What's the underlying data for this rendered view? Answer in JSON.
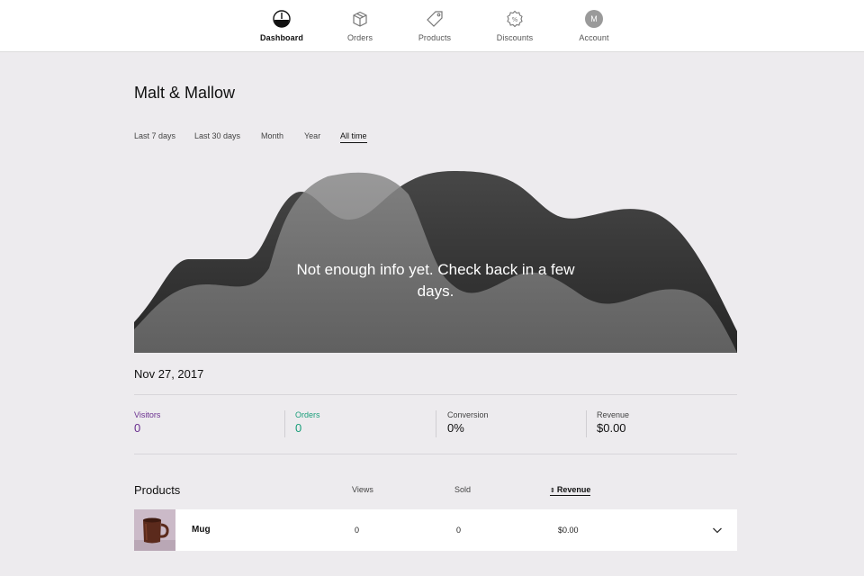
{
  "nav": {
    "items": [
      {
        "label": "Dashboard",
        "icon": "dashboard-gauge-icon",
        "active": true
      },
      {
        "label": "Orders",
        "icon": "box-icon"
      },
      {
        "label": "Products",
        "icon": "tag-icon"
      },
      {
        "label": "Discounts",
        "icon": "percent-badge-icon"
      },
      {
        "label": "Account",
        "icon": "avatar",
        "initial": "M"
      }
    ]
  },
  "store": {
    "title": "Malt & Mallow"
  },
  "ranges": [
    "Last 7 days",
    "Last 30 days",
    "Month",
    "Year",
    "All time"
  ],
  "active_range": "All time",
  "chart": {
    "message": "Not enough info yet. Check back in a few days."
  },
  "date": "Nov 27, 2017",
  "stats": [
    {
      "label": "Visitors",
      "value": "0",
      "color": "#6a2f8f"
    },
    {
      "label": "Orders",
      "value": "0",
      "color": "#1a9e7a"
    },
    {
      "label": "Conversion",
      "value": "0%"
    },
    {
      "label": "Revenue",
      "value": "$0.00"
    }
  ],
  "products": {
    "title": "Products",
    "columns": {
      "views": "Views",
      "sold": "Sold",
      "revenue": "Revenue"
    },
    "sorted_by": "Revenue",
    "rows": [
      {
        "name": "Mug",
        "views": "0",
        "sold": "0",
        "revenue": "$0.00"
      }
    ]
  }
}
